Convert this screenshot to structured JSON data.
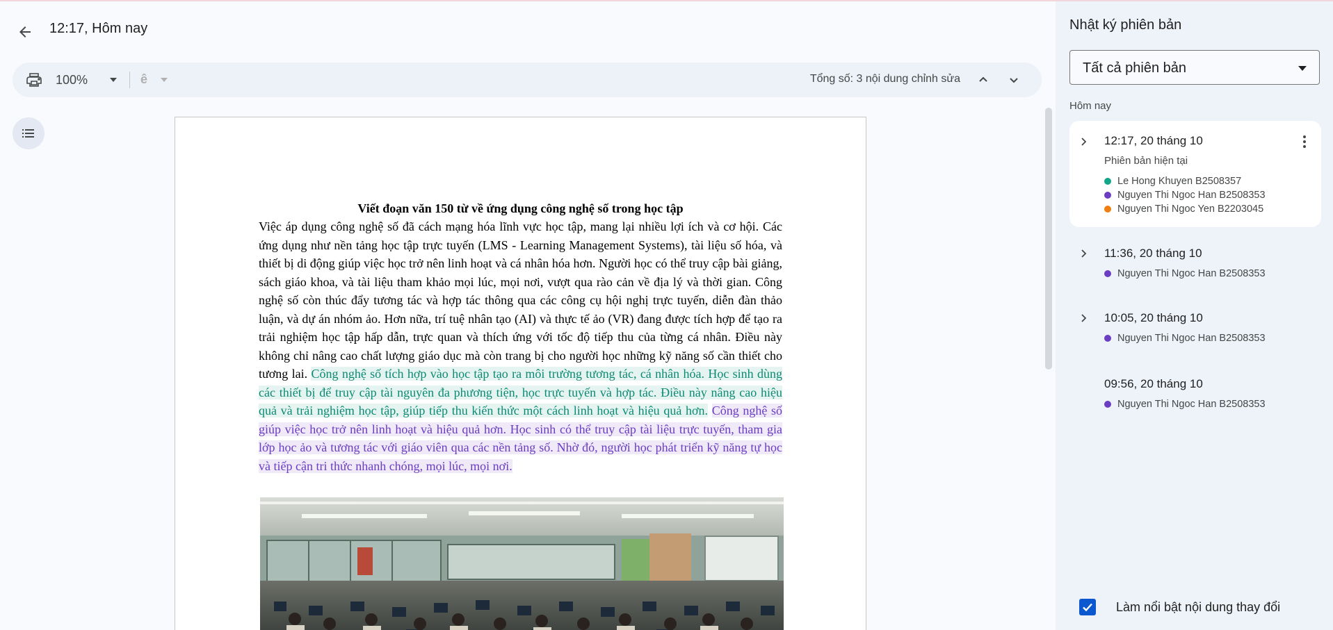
{
  "header": {
    "title": "12:17, Hôm nay"
  },
  "toolbar": {
    "zoom": "100%",
    "spell_glyph": "ê",
    "total_edits": "Tổng số: 3 nội dung chỉnh sửa"
  },
  "document": {
    "title": "Viết đoạn văn 150 từ về ứng dụng công nghệ số trong học tập",
    "paragraph_plain": "Việc áp dụng công nghệ số đã cách mạng hóa lĩnh vực học tập, mang lại nhiều lợi ích và cơ hội. Các ứng dụng như nền tảng học tập trực tuyến (LMS - Learning Management Systems), tài liệu số hóa, và thiết bị di động giúp việc học trở nên linh hoạt và cá nhân hóa hơn. Người học có thể truy cập bài giảng, sách giáo khoa, và tài liệu tham khảo mọi lúc, mọi nơi, vượt qua rào cản về địa lý và thời gian. Công nghệ số còn thúc đẩy tương tác và hợp tác thông qua các công cụ hội nghị trực tuyến, diễn đàn thảo luận, và dự án nhóm ảo. Hơn nữa, trí tuệ nhân tạo (AI) và thực tế ảo (VR) đang được tích hợp để tạo ra trải nghiệm học tập hấp dẫn, trực quan và thích ứng với tốc độ tiếp thu của từng cá nhân. Điều này không chỉ nâng cao chất lượng giáo dục mà còn trang bị cho người học những kỹ năng số cần thiết cho tương lai.",
    "paragraph_green": "Công nghệ số tích hợp vào học tập tạo ra môi trường tương tác, cá nhân hóa. Học sinh dùng các thiết bị để truy cập tài nguyên đa phương tiện, học trực tuyến và hợp tác. Điều này nâng cao hiệu quả và trải nghiệm học tập, giúp tiếp thu kiến thức một cách linh hoạt và hiệu quả hơn.",
    "paragraph_purple": "Công nghệ số giúp việc học trở nên linh hoạt và hiệu quả hơn. Học sinh có thể truy cập tài liệu trực tuyến, tham gia lớp học ảo và tương tác với giáo viên qua các nền tảng số. Nhờ đó, người học phát triển kỹ năng tự học và tiếp cận tri thức nhanh chóng, mọi lúc, mọi nơi."
  },
  "panel": {
    "title": "Nhật ký phiên bản",
    "select_value": "Tất cả phiên bản",
    "section_label": "Hôm nay",
    "versions": [
      {
        "time": "12:17, 20 tháng 10",
        "subtitle": "Phiên bản hiện tại",
        "editors": [
          {
            "name": "Le Hong Khuyen B2508357",
            "color": "#12a58a"
          },
          {
            "name": "Nguyen Thi Ngoc Han B2508353",
            "color": "#6a3dc2"
          },
          {
            "name": "Nguyen Thi Ngoc Yen B2203045",
            "color": "#f07f12"
          }
        ]
      },
      {
        "time": "11:36, 20 tháng 10",
        "editors": [
          {
            "name": "Nguyen Thi Ngoc Han B2508353",
            "color": "#6a3dc2"
          }
        ]
      },
      {
        "time": "10:05, 20 tháng 10",
        "editors": [
          {
            "name": "Nguyen Thi Ngoc Han B2508353",
            "color": "#6a3dc2"
          }
        ]
      },
      {
        "time": "09:56, 20 tháng 10",
        "editors": [
          {
            "name": "Nguyen Thi Ngoc Han B2508353",
            "color": "#6a3dc2"
          }
        ]
      }
    ],
    "highlight_label": "Làm nổi bật nội dung thay đổi",
    "highlight_checked": true
  },
  "colors": {
    "accent": "#0b57d0",
    "green_edit": "#0b8a73",
    "purple_edit": "#6a3dc2"
  },
  "icons": [
    "back-arrow-icon",
    "print-icon",
    "chevron-down-icon",
    "chevron-up-icon",
    "outline-list-icon",
    "chevron-right-icon",
    "more-vert-icon",
    "checkmark-icon"
  ]
}
